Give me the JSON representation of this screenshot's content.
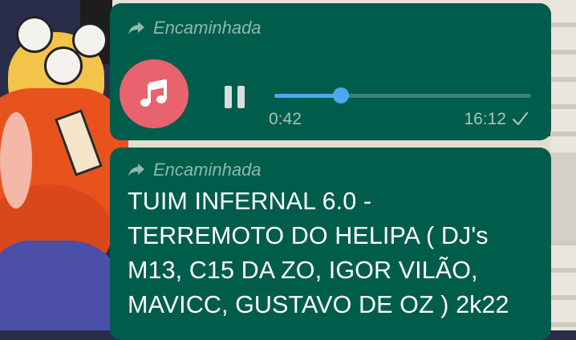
{
  "colors": {
    "bubble_bg": "#005c4b",
    "accent_progress": "#4aa9f5",
    "audio_avatar_bg": "#e9636e"
  },
  "audio_message": {
    "forwarded_label": "Encaminhada",
    "forwarded_icon": "forward-arrow-icon",
    "avatar_icon": "music-note-icon",
    "control_icon": "pause-icon",
    "elapsed": "0:42",
    "progress": 0.26,
    "sent_time": "16:12",
    "status_icon": "single-check-icon"
  },
  "text_message": {
    "forwarded_label": "Encaminhada",
    "forwarded_icon": "forward-arrow-icon",
    "lines": [
      "TUIM INFERNAL 6.0 -",
      "TERREMOTO DO HELIPA ( DJ's",
      "M13, C15 DA ZO, IGOR VILÃO,",
      "MAVICC, GUSTAVO DE OZ ) 2k22"
    ]
  }
}
